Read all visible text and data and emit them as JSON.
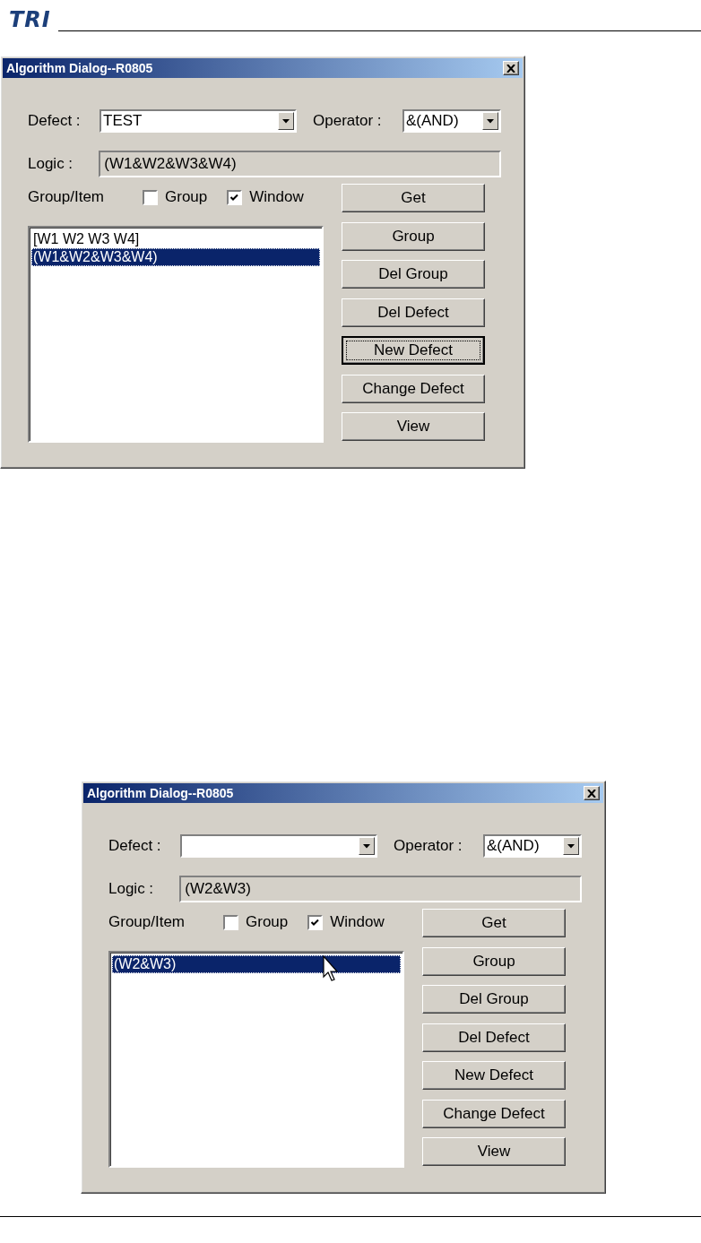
{
  "header": {
    "logo": "TRI"
  },
  "dialogs": [
    {
      "title": "Algorithm Dialog--R0805",
      "defect_label": "Defect :",
      "defect": "TEST",
      "operator_label": "Operator :",
      "operator": "&(AND)",
      "logic_label": "Logic :",
      "logic": "(W1&W2&W3&W4)",
      "group_item_label": "Group/Item",
      "checkboxes": [
        {
          "label": "Group",
          "checked": false
        },
        {
          "label": "Window",
          "checked": true
        }
      ],
      "items": [
        {
          "text": "[W1 W2 W3 W4]",
          "selected": false
        },
        {
          "text": "(W1&W2&W3&W4)",
          "selected": true
        }
      ],
      "buttons": [
        {
          "label": "Get",
          "focused": false
        },
        {
          "label": "Group",
          "focused": false
        },
        {
          "label": "Del Group",
          "focused": false
        },
        {
          "label": "Del Defect",
          "focused": false
        },
        {
          "label": "New Defect",
          "focused": true
        },
        {
          "label": "Change Defect",
          "focused": false
        },
        {
          "label": "View",
          "focused": false
        }
      ],
      "mouse_pointer": false
    },
    {
      "title": "Algorithm Dialog--R0805",
      "defect_label": "Defect :",
      "operator_label": "Operator :",
      "operator": "&(AND)",
      "logic_label": "Logic :",
      "logic": "(W2&W3)",
      "group_item_label": "Group/Item",
      "checkboxes": [
        {
          "label": "Group",
          "checked": false
        },
        {
          "label": "Window",
          "checked": true
        }
      ],
      "items": [
        {
          "text": "(W2&W3)",
          "selected": true
        }
      ],
      "buttons": [
        {
          "label": "Get",
          "focused": false
        },
        {
          "label": "Group",
          "focused": false
        },
        {
          "label": "Del Group",
          "focused": false
        },
        {
          "label": "Del Defect",
          "focused": false
        },
        {
          "label": "New Defect",
          "focused": false
        },
        {
          "label": "Change Defect",
          "focused": false
        },
        {
          "label": "View",
          "focused": false
        }
      ],
      "mouse_pointer": true
    }
  ]
}
